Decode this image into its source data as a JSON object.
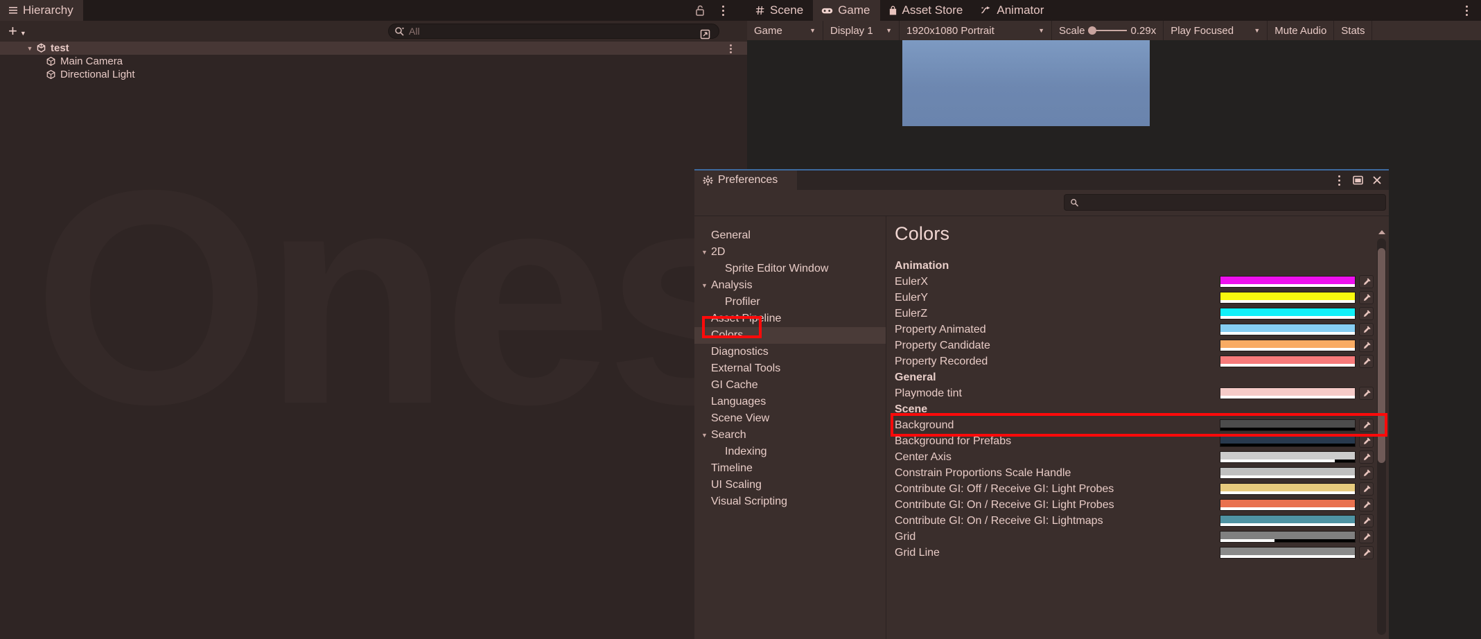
{
  "hierarchy": {
    "tab_label": "Hierarchy",
    "lock_icon": "lock-open-icon",
    "kebab_icon": "kebab-menu-icon",
    "add_label": "+",
    "search": {
      "placeholder": "All",
      "value": "",
      "icon": "search-icon",
      "expand_icon": "expand-search-icon"
    },
    "items": [
      {
        "label": "test",
        "icon": "unity-scene-icon",
        "depth": 0,
        "selected": true,
        "expanded": true
      },
      {
        "label": "Main Camera",
        "icon": "gameobject-cube-icon",
        "depth": 1,
        "selected": false
      },
      {
        "label": "Directional Light",
        "icon": "gameobject-cube-icon",
        "depth": 1,
        "selected": false
      }
    ]
  },
  "watermark": {
    "text": "Onese"
  },
  "game_dock": {
    "tabs": [
      {
        "label": "Scene",
        "icon": "scene-hash-icon",
        "active": false
      },
      {
        "label": "Game",
        "icon": "game-controller-icon",
        "active": true
      },
      {
        "label": "Asset Store",
        "icon": "asset-store-bag-icon",
        "active": false
      },
      {
        "label": "Animator",
        "icon": "animator-icon",
        "active": false
      }
    ],
    "kebab_icon": "kebab-menu-icon",
    "toolbar": {
      "game_dropdown": "Game",
      "display_dropdown": "Display 1",
      "resolution_dropdown": "1920x1080 Portrait",
      "scale_label": "Scale",
      "scale_value": "0.29x",
      "play_mode_dropdown": "Play Focused",
      "mute_audio": "Mute Audio",
      "stats": "Stats"
    }
  },
  "preferences": {
    "title": "Preferences",
    "gear_icon": "gear-icon",
    "kebab_icon": "kebab-menu-icon",
    "maximize_icon": "maximize-icon",
    "close_icon": "close-icon",
    "search": {
      "placeholder": "",
      "value": "",
      "icon": "search-icon"
    },
    "sidebar": [
      {
        "label": "General",
        "indent": 0,
        "fold": "",
        "selected": false
      },
      {
        "label": "2D",
        "indent": 0,
        "fold": "▼",
        "selected": false
      },
      {
        "label": "Sprite Editor Window",
        "indent": 1,
        "fold": "",
        "selected": false
      },
      {
        "label": "Analysis",
        "indent": 0,
        "fold": "▼",
        "selected": false
      },
      {
        "label": "Profiler",
        "indent": 1,
        "fold": "",
        "selected": false
      },
      {
        "label": "Asset Pipeline",
        "indent": 0,
        "fold": "",
        "selected": false
      },
      {
        "label": "Colors",
        "indent": 0,
        "fold": "",
        "selected": true
      },
      {
        "label": "Diagnostics",
        "indent": 0,
        "fold": "",
        "selected": false
      },
      {
        "label": "External Tools",
        "indent": 0,
        "fold": "",
        "selected": false
      },
      {
        "label": "GI Cache",
        "indent": 0,
        "fold": "",
        "selected": false
      },
      {
        "label": "Languages",
        "indent": 0,
        "fold": "",
        "selected": false
      },
      {
        "label": "Scene View",
        "indent": 0,
        "fold": "",
        "selected": false
      },
      {
        "label": "Search",
        "indent": 0,
        "fold": "▼",
        "selected": false
      },
      {
        "label": "Indexing",
        "indent": 1,
        "fold": "",
        "selected": false
      },
      {
        "label": "Timeline",
        "indent": 0,
        "fold": "",
        "selected": false
      },
      {
        "label": "UI Scaling",
        "indent": 0,
        "fold": "",
        "selected": false
      },
      {
        "label": "Visual Scripting",
        "indent": 0,
        "fold": "",
        "selected": false
      }
    ],
    "content": {
      "heading": "Colors",
      "eyedropper_icon": "eyedropper-icon",
      "rows": [
        {
          "type": "group",
          "label": "Animation"
        },
        {
          "type": "color",
          "label": "EulerX",
          "color": "#ee10ee",
          "alpha": 100
        },
        {
          "type": "color",
          "label": "EulerY",
          "color": "#f8f80e",
          "alpha": 100
        },
        {
          "type": "color",
          "label": "EulerZ",
          "color": "#0ff0f8",
          "alpha": 100
        },
        {
          "type": "color",
          "label": "Property Animated",
          "color": "#86cdf2",
          "alpha": 100
        },
        {
          "type": "color",
          "label": "Property Candidate",
          "color": "#f9ab63",
          "alpha": 100
        },
        {
          "type": "color",
          "label": "Property Recorded",
          "color": "#f77b7b",
          "alpha": 100
        },
        {
          "type": "group",
          "label": "General"
        },
        {
          "type": "color",
          "label": "Playmode tint",
          "color": "#f5cbc8",
          "alpha": 100,
          "highlighted": true
        },
        {
          "type": "group",
          "label": "Scene"
        },
        {
          "type": "color",
          "label": "Background",
          "color": "#4c4c4c",
          "alpha": 0
        },
        {
          "type": "color",
          "label": "Background for Prefabs",
          "color": "#28394d",
          "alpha": 0
        },
        {
          "type": "color",
          "label": "Center Axis",
          "color": "#cccccc",
          "alpha": 85
        },
        {
          "type": "color",
          "label": "Constrain Proportions Scale Handle",
          "color": "#bfbfbf",
          "alpha": 100
        },
        {
          "type": "color",
          "label": "Contribute GI: Off / Receive GI: Light Probes",
          "color": "#e8cb7e",
          "alpha": 100
        },
        {
          "type": "color",
          "label": "Contribute GI: On / Receive GI: Light Probes",
          "color": "#e9714f",
          "alpha": 100
        },
        {
          "type": "color",
          "label": "Contribute GI: On / Receive GI: Lightmaps",
          "color": "#4f93a3",
          "alpha": 100
        },
        {
          "type": "color",
          "label": "Grid",
          "color": "#808080",
          "alpha": 40
        },
        {
          "type": "color",
          "label": "Grid Line",
          "color": "#8a8a8a",
          "alpha": 100
        }
      ]
    }
  },
  "annotations": [
    {
      "name": "colors-sidebar-highlight",
      "color": "#ff0a0a"
    },
    {
      "name": "playmode-tint-highlight",
      "color": "#ff0a0a"
    }
  ]
}
